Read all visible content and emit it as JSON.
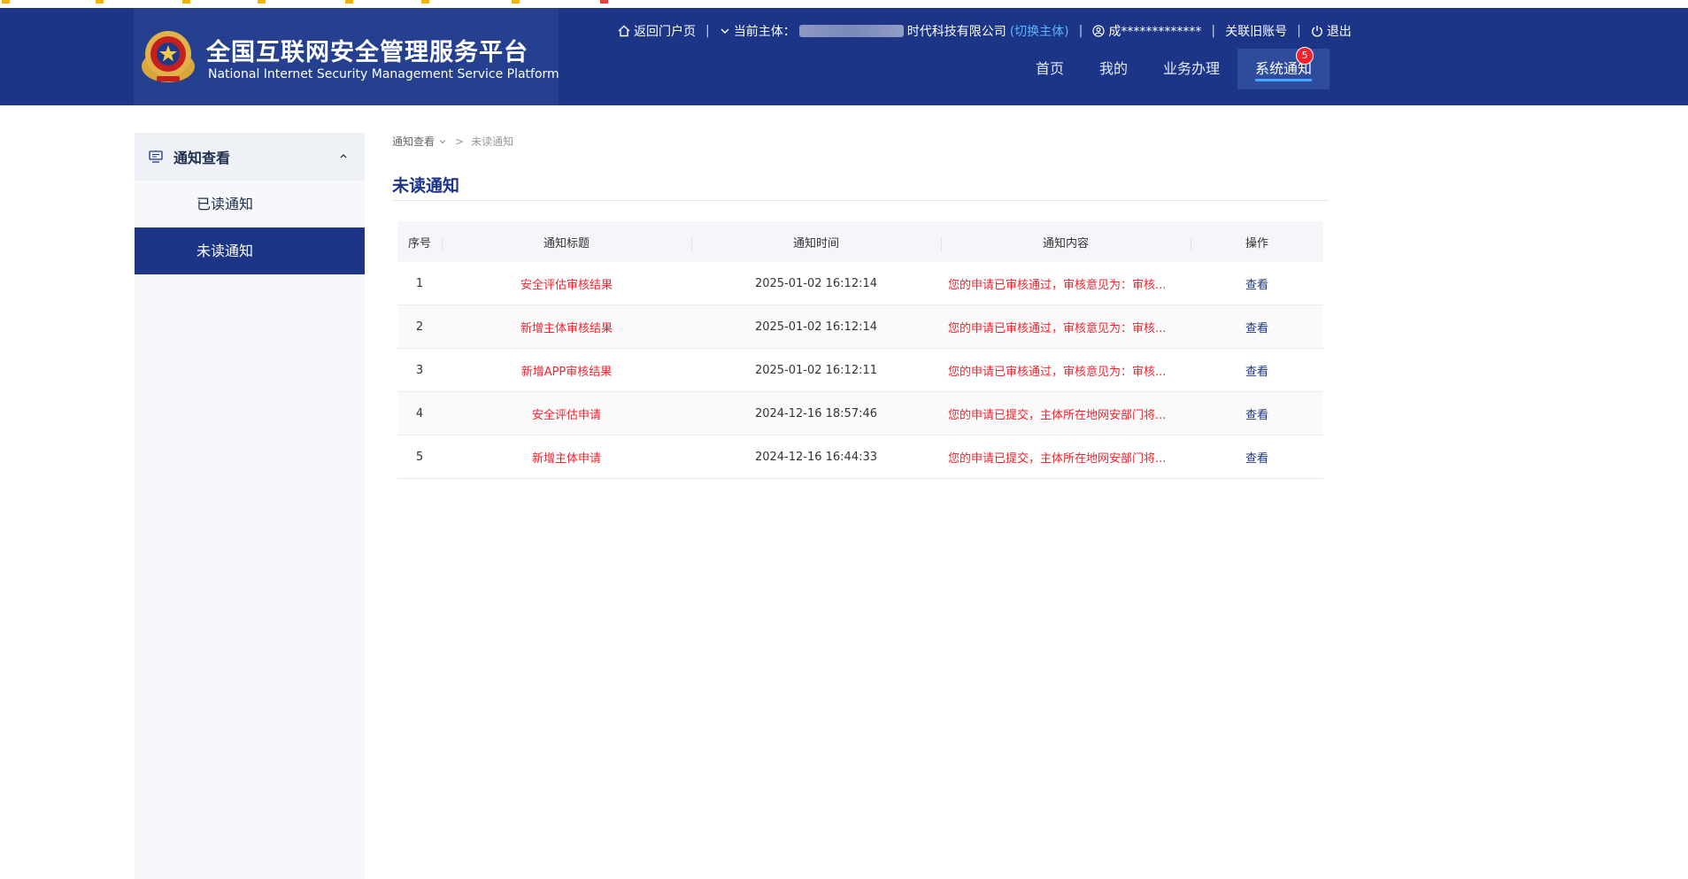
{
  "header": {
    "title_cn": "全国互联网安全管理服务平台",
    "title_en": "National Internet Security Management Service Platform",
    "home_link": "返回门户页",
    "subject_prefix": "当前主体：",
    "subject_suffix": "时代科技有限公司",
    "switch_subject": "(切换主体)",
    "user": "成*************",
    "link_old_account": "关联旧账号",
    "logout": "退出",
    "nav": [
      {
        "label": "首页"
      },
      {
        "label": "我的"
      },
      {
        "label": "业务办理"
      },
      {
        "label": "系统通知",
        "badge": "5"
      }
    ]
  },
  "sidebar": {
    "group": "通知查看",
    "items": [
      {
        "label": "已读通知"
      },
      {
        "label": "未读通知"
      }
    ]
  },
  "breadcrumb": {
    "parent": "通知查看",
    "sep": ">",
    "current": "未读通知"
  },
  "page_title": "未读通知",
  "table": {
    "headers": [
      "序号",
      "通知标题",
      "通知时间",
      "通知内容",
      "操作"
    ],
    "rows": [
      {
        "no": "1",
        "title": "安全评估审核结果",
        "time": "2025-01-02 16:12:14",
        "content": "您的申请已审核通过，审核意见为：审核...",
        "action": "查看"
      },
      {
        "no": "2",
        "title": "新增主体审核结果",
        "time": "2025-01-02 16:12:14",
        "content": "您的申请已审核通过，审核意见为：审核...",
        "action": "查看"
      },
      {
        "no": "3",
        "title": "新增APP审核结果",
        "time": "2025-01-02 16:12:11",
        "content": "您的申请已审核通过，审核意见为：审核...",
        "action": "查看"
      },
      {
        "no": "4",
        "title": "安全评估申请",
        "time": "2024-12-16 18:57:46",
        "content": "您的申请已提交，主体所在地网安部门将...",
        "action": "查看"
      },
      {
        "no": "5",
        "title": "新增主体申请",
        "time": "2024-12-16 16:44:33",
        "content": "您的申请已提交，主体所在地网安部门将...",
        "action": "查看"
      }
    ]
  },
  "colors": {
    "primary": "#1c3587",
    "accent": "#3ea7ff",
    "alert": "#f5222d"
  }
}
